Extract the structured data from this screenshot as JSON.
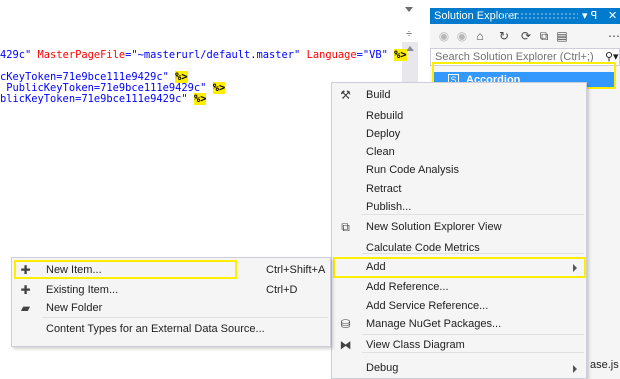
{
  "editor": {
    "code_lines": [
      [
        {
          "t": "429c\" ",
          "c": "c-str"
        },
        {
          "t": "MasterPageFile",
          "c": "c-attr"
        },
        {
          "t": "=\"~masterurl/default.master\" ",
          "c": "c-str"
        },
        {
          "t": "Language",
          "c": "c-attr"
        },
        {
          "t": "=\"VB\" ",
          "c": "c-str"
        },
        {
          "t": "%>",
          "c": "c-dir"
        }
      ],
      [],
      [
        {
          "t": "cKeyToken=71e9bce111e9429c\" ",
          "c": "c-str"
        },
        {
          "t": "%>",
          "c": "c-dir"
        }
      ],
      [
        {
          "t": " PublicKeyToken=71e9bce111e9429c\" ",
          "c": "c-str"
        },
        {
          "t": "%>",
          "c": "c-dir"
        }
      ],
      [
        {
          "t": "blicKeyToken=71e9bce111e9429c\" ",
          "c": "c-str"
        },
        {
          "t": "%>",
          "c": "c-dir"
        }
      ]
    ]
  },
  "solution_explorer": {
    "title": "Solution Explorer",
    "pin_glyph": "▾ ꟼ",
    "close_glyph": "✕",
    "search_placeholder": "Search Solution Explorer (Ctrl+;)",
    "selected_item": "Accordion",
    "selected_item_icon": "S",
    "bottom_partial_text": "ase.js"
  },
  "context_menu": {
    "items": [
      {
        "label": "Build",
        "icon": "build-icon",
        "glyph": "⚒"
      },
      {
        "label": "Rebuild"
      },
      {
        "label": "Deploy"
      },
      {
        "label": "Clean"
      },
      {
        "label": "Run Code Analysis"
      },
      {
        "label": "Retract"
      },
      {
        "label": "Publish..."
      },
      {
        "label": "New Solution Explorer View",
        "icon": "new-view-icon",
        "glyph": "⧉"
      },
      {
        "label": "Calculate Code Metrics"
      },
      {
        "label": "Add",
        "has_submenu": true
      },
      {
        "label": "Add Reference..."
      },
      {
        "label": "Add Service Reference..."
      },
      {
        "label": "Manage NuGet Packages...",
        "icon": "nuget-icon",
        "glyph": "⛁"
      },
      {
        "label": "View Class Diagram",
        "icon": "class-diagram-icon",
        "glyph": "⧓"
      },
      {
        "label": "Debug",
        "has_submenu": true
      }
    ]
  },
  "add_submenu": {
    "items": [
      {
        "label": "New Item...",
        "shortcut": "Ctrl+Shift+A",
        "icon": "new-item-icon",
        "glyph": "✚"
      },
      {
        "label": "Existing Item...",
        "shortcut": "Ctrl+D",
        "icon": "existing-item-icon",
        "glyph": "✚"
      },
      {
        "label": "New Folder",
        "icon": "new-folder-icon",
        "glyph": "▰"
      },
      {
        "label": "Content Types for an External Data Source..."
      }
    ]
  },
  "colors": {
    "accent": "#007acc",
    "selection": "#3399ff",
    "highlight_box": "#ffee00"
  }
}
